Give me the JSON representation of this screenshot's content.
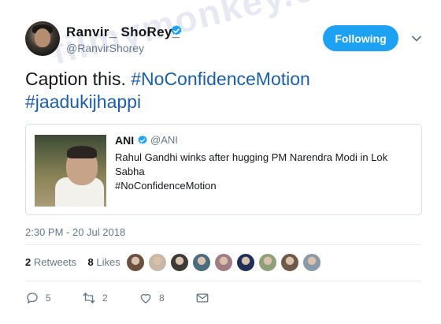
{
  "author": {
    "display_name": "Ranvir_ ShoRey_",
    "handle": "@RanvirShorey",
    "verified": true
  },
  "follow_button": {
    "label": "Following"
  },
  "tweet": {
    "text_prefix": "Caption this. ",
    "hashtag1": "#NoConfidenceMotion",
    "hashtag2": "#jaadukijhappi"
  },
  "quote": {
    "name": "ANI",
    "handle": "@ANI",
    "line1": "Rahul Gandhi winks after hugging PM Narendra Modi in Lok Sabha",
    "line2": "#NoConfidenceMotion"
  },
  "timestamp": "2:30 PM - 20 Jul 2018",
  "stats": {
    "retweets_count": "2",
    "retweets_label": "Retweets",
    "likes_count": "8",
    "likes_label": "Likes"
  },
  "likers_colors": [
    "#6b4f3f",
    "#c9b8a6",
    "#3e3a38",
    "#4a6c7d",
    "#a07c84",
    "#1f2f58",
    "#8ea07a",
    "#6f5a4a",
    "#8a9aa8"
  ],
  "actions": {
    "replies": "5",
    "retweets": "2",
    "likes": "8"
  },
  "watermark": "filmymonkey.com",
  "colors": {
    "accent": "#1da1f2",
    "hashtag": "#1b5fa8",
    "muted": "#657786"
  }
}
